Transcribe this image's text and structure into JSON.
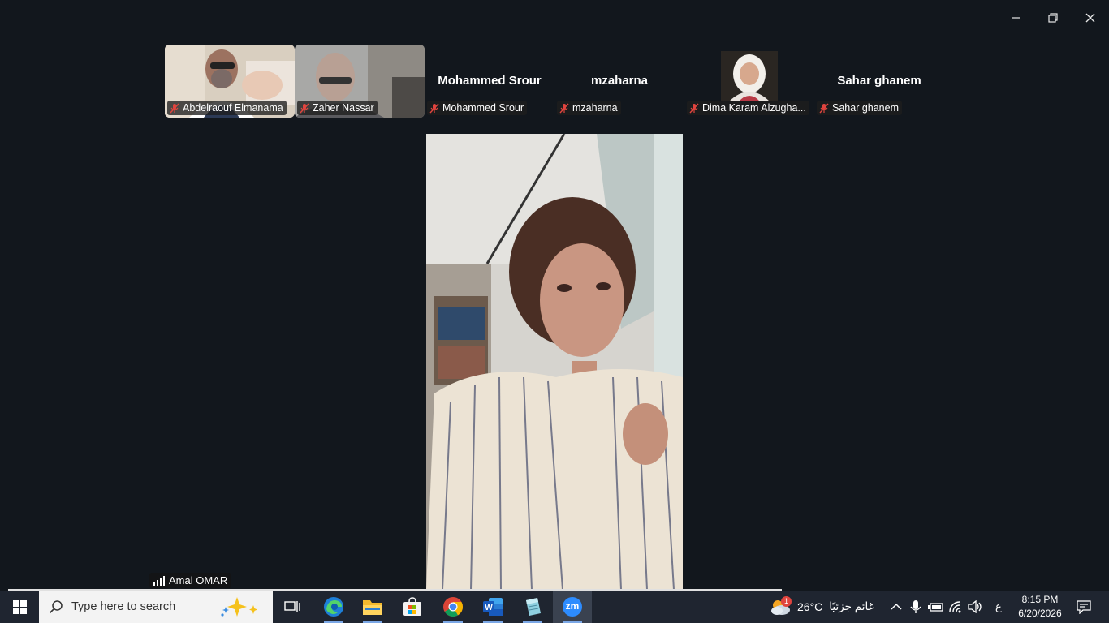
{
  "window": {
    "minimize_icon": "minimize-icon",
    "maximize_icon": "restore-icon",
    "close_icon": "close-icon"
  },
  "participants": [
    {
      "name": "Abdelraouf Elmanama",
      "display": "",
      "video": true,
      "muted": true
    },
    {
      "name": "Zaher Nassar",
      "display": "",
      "video": true,
      "muted": true
    },
    {
      "name": "Mohammed Srour",
      "display": "Mohammed Srour",
      "video": false,
      "muted": true
    },
    {
      "name": "mzaharna",
      "display": "mzaharna",
      "video": false,
      "muted": true
    },
    {
      "name": "Dima Karam Alzugha...",
      "display": "",
      "video": true,
      "muted": true
    },
    {
      "name": "Sahar ghanem",
      "display": "Sahar ghanem",
      "video": false,
      "muted": true
    }
  ],
  "speaker": {
    "name": "Amal OMAR",
    "icon": "signal-bars-icon"
  },
  "taskbar": {
    "search_placeholder": "Type here to search",
    "weather_badge": "1",
    "temperature": "26°C",
    "weather_text": "غائم جزئيًا",
    "language": "ع",
    "time": "8:15 PM",
    "date": "6/20/2026",
    "zoom_label": "zm"
  },
  "colors": {
    "background": "#12171d",
    "taskbar": "#1f2530",
    "mic_off": "#e0443e",
    "accent": "#7aa7e6"
  }
}
